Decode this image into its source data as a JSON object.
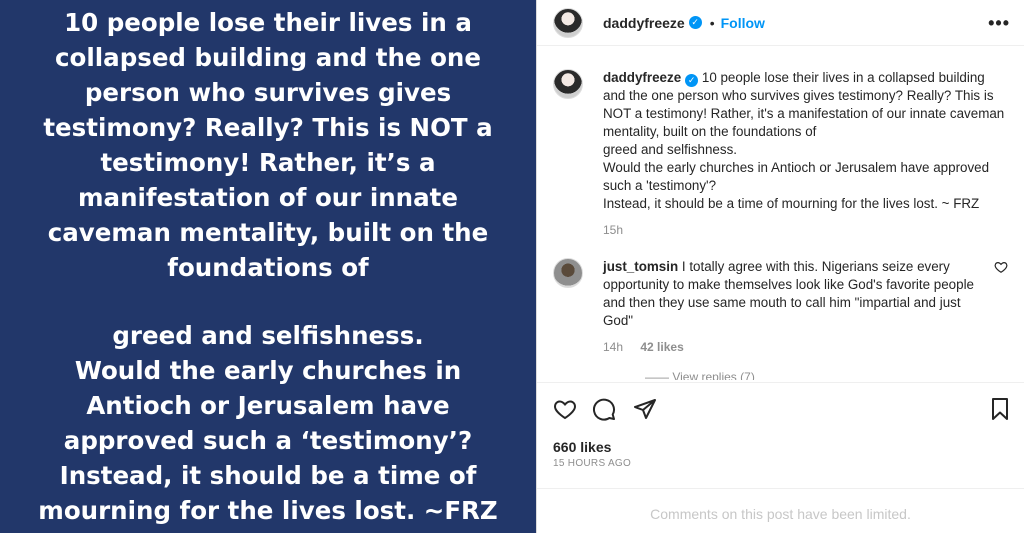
{
  "post_image": {
    "lines_1": [
      "10 people lose their lives in a",
      "collapsed building and the one",
      "person who survives gives",
      "testimony? Really? This is NOT a",
      "testimony! Rather, it’s a",
      "manifestation of our innate",
      "caveman mentality, built on the",
      "foundations of"
    ],
    "lines_2": [
      "greed and selfishness.",
      "Would the early churches in",
      "Antioch or Jerusalem have",
      "approved such a ‘testimony’?",
      "Instead, it should be a time of",
      "mourning for the lives lost. ~FRZ"
    ],
    "background": "#22376a"
  },
  "header": {
    "username": "daddyfreeze",
    "separator": "•",
    "follow_label": "Follow",
    "more_label": "•••"
  },
  "caption": {
    "username": "daddyfreeze",
    "text": "10 people lose their lives in a collapsed building and the one person who survives gives testimony? Really? This is NOT a testimony! Rather, it's a manifestation of our innate caveman mentality, built on the foundations of",
    "text2": "greed and selfishness.",
    "text3": "Would the early churches in Antioch or Jerusalem have approved such a 'testimony'?",
    "text4": "Instead, it should be a time of mourning for the lives lost. ~ FRZ",
    "time": "15h"
  },
  "comment": {
    "username": "just_tomsin",
    "text": "I totally agree with this. Nigerians seize every opportunity to make themselves look like God's favorite people and then they use same mouth to call him \"impartial and just God\"",
    "time": "14h",
    "likes": "42 likes",
    "view_replies": "—— View replies (7)"
  },
  "actions": {
    "like_icon": "heart-icon",
    "comment_icon": "comment-icon",
    "share_icon": "share-icon",
    "save_icon": "bookmark-icon",
    "likes": "660 likes",
    "timestamp": "15 HOURS AGO",
    "comments_limited": "Comments on this post have been limited."
  },
  "colors": {
    "accent": "#0095f6",
    "text": "#262626",
    "muted": "#8e8e8e"
  }
}
